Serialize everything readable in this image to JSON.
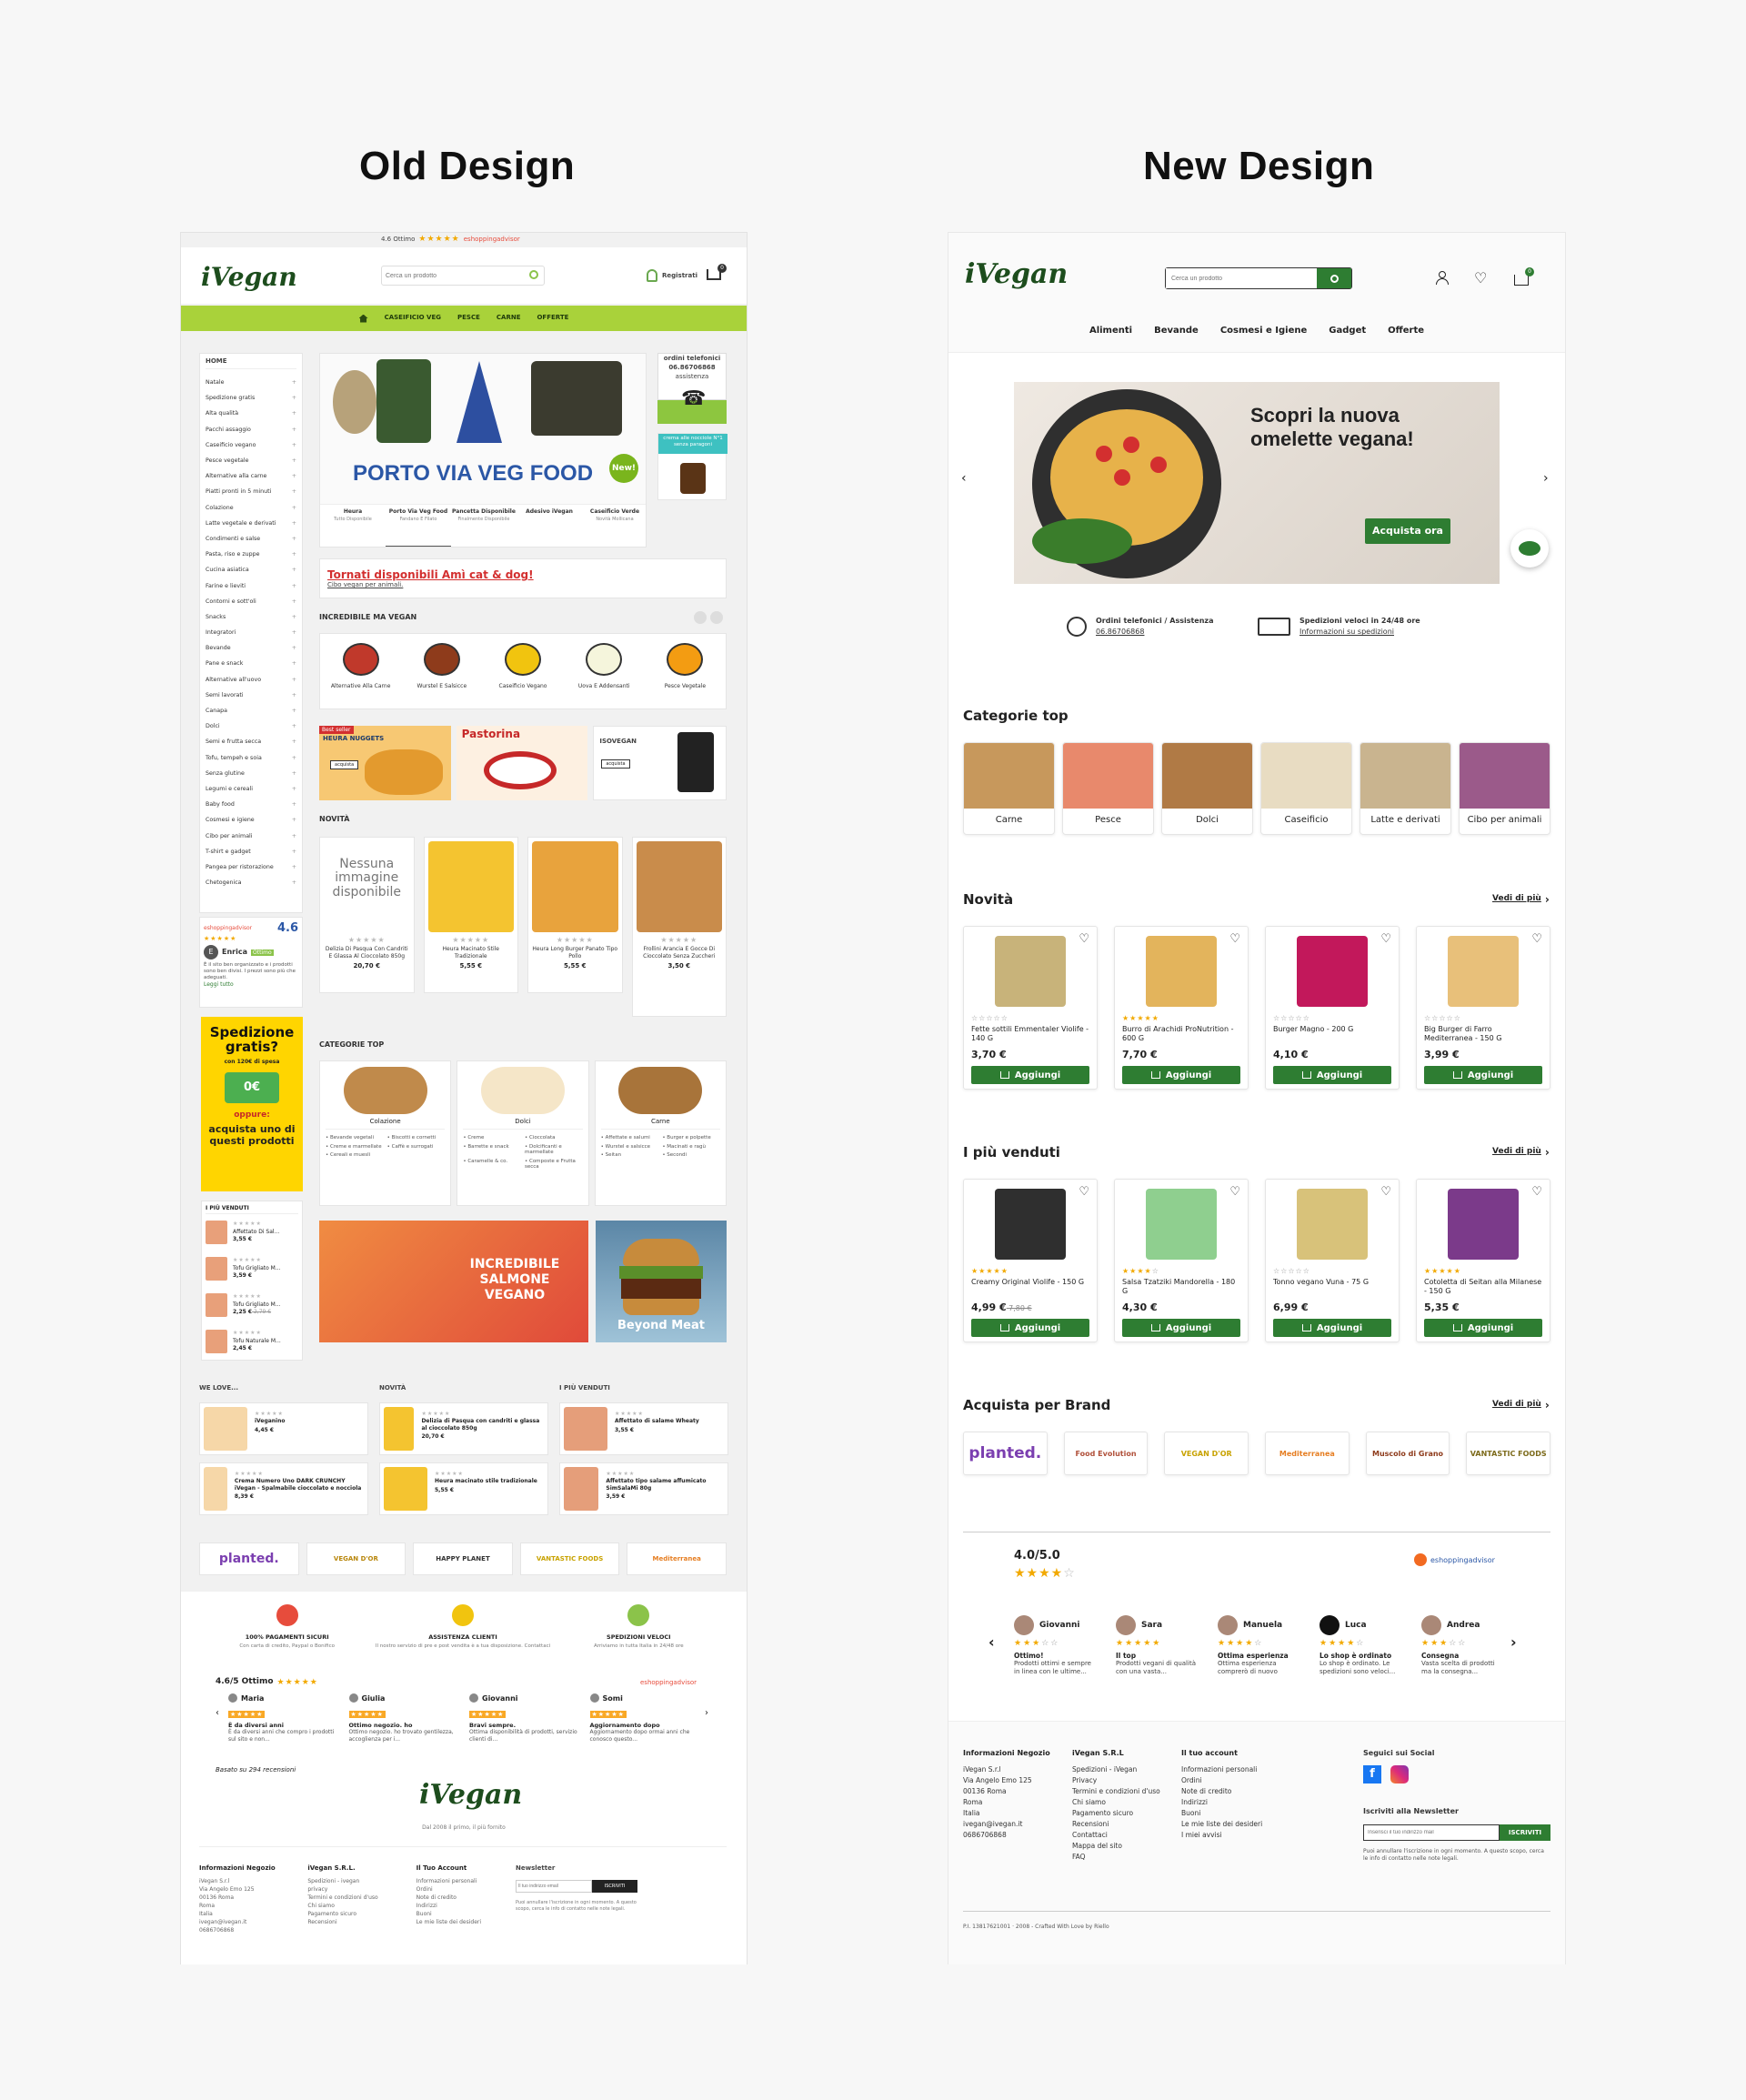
{
  "titles": {
    "old": "Old Design",
    "new": "New Design"
  },
  "old": {
    "rating_bar": "4.6 Ottimo",
    "rating_brand": "eshoppingadvisor",
    "logo": "iVegan",
    "search_placeholder": "Cerca un prodotto",
    "register": "Registrati",
    "cart_count": "0",
    "nav": [
      "CASEIFICIO VEG",
      "PESCE",
      "CARNE",
      "OFFERTE"
    ],
    "sidebar_home": "HOME",
    "sidebar": [
      "Natale",
      "Spedizione gratis",
      "Alta qualità",
      "Pacchi assaggio",
      "Caseificio vegano",
      "Pesce vegetale",
      "Alternative alla carne",
      "Piatti pronti in 5 minuti",
      "Colazione",
      "Latte vegetale e derivati",
      "Condimenti e salse",
      "Pasta, riso e zuppe",
      "Cucina asiatica",
      "Farine e lieviti",
      "Contorni e sott'oli",
      "Snacks",
      "Integratori",
      "Bevande",
      "Pane e snack",
      "Alternative all'uovo",
      "Semi lavorati",
      "Canapa",
      "Dolci",
      "Semi e frutta secca",
      "Tofu, tempeh e soia",
      "Senza glutine",
      "Legumi e cereali",
      "Baby food",
      "Cosmesi e igiene",
      "Cibo per animali",
      "T-shirt e gadget",
      "Pangea per ristorazione",
      "Chetogenica"
    ],
    "hero_text": "PORTO VIA VEG FOOD",
    "hero_badge": "New!",
    "hero_tabs": [
      {
        "t": "Heura",
        "s": "Tutto Disponibile"
      },
      {
        "t": "Porto Via Veg Food",
        "s": "Fandano E Filato"
      },
      {
        "t": "Pancetta Disponibile",
        "s": "Finalmente Disponibile"
      },
      {
        "t": "Adesivo iVegan",
        "s": ""
      },
      {
        "t": "Caseificio Verde",
        "s": "Novità Mollicana"
      }
    ],
    "phone_title": "ordini telefonici",
    "phone_number": "06.86706868",
    "phone_sub": "assistenza",
    "promo_side": "crema alle nocciole N°1 senza paragoni",
    "back_title": "Tornati disponibili Amì cat & dog!",
    "back_sub": "Cibo vegan per animali.",
    "incredibile_title": "INCREDIBILE MA VEGAN",
    "incredibile": [
      "Alternative Alla Carne",
      "Wurstel E Salsicce",
      "Caseificio Vegano",
      "Uova E Addensanti",
      "Pesce Vegetale"
    ],
    "banners": [
      "HEURA NUGGETS",
      "Pastorina",
      "ISOVEGAN"
    ],
    "banner_badge": "Best seller",
    "banner_btn": "acquista",
    "novita_title": "NOVITÀ",
    "no_image": "Nessuna immagine disponibile",
    "novita": [
      {
        "n": "Delizia Di Pasqua Con Candriti E Glassa Al Cioccolato 850g",
        "p": "20,70 €"
      },
      {
        "n": "Heura Macinato Stile Tradizionale",
        "p": "5,55 €"
      },
      {
        "n": "Heura Long Burger Panato Tipo Pollo",
        "p": "5,55 €"
      },
      {
        "n": "Frollini Arancia E Gocce Di Cioccolato Senza Zuccheri",
        "p": "3,50 €"
      }
    ],
    "review_score": "4.6",
    "review_name": "Enrica",
    "review_badge": "Ottimo",
    "review_text": "È il sito ben organizzato e i prodotti sono ben divisi. I prezzi sono più che adeguati.",
    "review_more": "Leggi tutto",
    "ship_title": "Spedizione gratis?",
    "ship_sub": "con 120€ di spesa",
    "ship_price": "0€",
    "ship_or": "oppure:",
    "ship_cta": "acquista uno di questi prodotti",
    "bestseller_title": "I PIÙ VENDUTI",
    "bestsellers": [
      {
        "n": "Affettato Di Sal...",
        "p": "3,55 €",
        "o": ""
      },
      {
        "n": "Tofu Grigliato M...",
        "p": "3,59 €",
        "o": ""
      },
      {
        "n": "Tofu Grigliato M...",
        "p": "2,25 €",
        "o": "2,79 €"
      },
      {
        "n": "Tofu Naturale M...",
        "p": "2,45 €",
        "o": ""
      }
    ],
    "cat_top_title": "CATEGORIE TOP",
    "cat_top": [
      {
        "t": "Colazione",
        "l": [
          "Bevande vegetali",
          "Biscotti e cornetti",
          "Creme e marmellate",
          "Caffè e surrogati",
          "Cereali e muesli"
        ]
      },
      {
        "t": "Dolci",
        "l": [
          "Creme",
          "Cioccolata",
          "Barrette e snack",
          "Dolcificanti e marmellate",
          "Caramelle & co.",
          "Composte e Frutta secca"
        ]
      },
      {
        "t": "Carne",
        "l": [
          "Affettate e salumi",
          "Burger e polpette",
          "Wurstel e salsicce",
          "Macinati e ragù",
          "Seitan",
          "Secondi"
        ]
      }
    ],
    "promo1": "INCREDIBILE SALMONE VEGANO",
    "promo2": "Beyond Meat",
    "welove_title": "WE LOVE...",
    "welove": [
      {
        "n": "iVeganino",
        "p": "4,45 €"
      },
      {
        "n": "Crema Numero Uno DARK CRUNCHY iVegan - Spalmabile cioccolato e nocciola",
        "p": "8,39 €"
      }
    ],
    "novita2_title": "NOVITÀ",
    "novita2": [
      {
        "n": "Delizia di Pasqua con candriti e glassa al cioccolato 850g",
        "p": "20,70 €"
      },
      {
        "n": "Heura macinato stile tradizionale",
        "p": "5,55 €"
      }
    ],
    "piu2_title": "I PIÙ VENDUTI",
    "piu2": [
      {
        "n": "Affettato di salame Wheaty",
        "p": "3,55 €"
      },
      {
        "n": "Affettato tipo salame affumicato SimSalaMi 80g",
        "p": "3,59 €"
      }
    ],
    "brands": [
      "planted.",
      "VEGAN D'OR",
      "HAPPY PLANET",
      "VANTASTIC FOODS",
      "Mediterranea"
    ],
    "features": [
      {
        "t": "100% PAGAMENTI SICURI",
        "s": "Con carta di credito, Paypal o Bonifico"
      },
      {
        "t": "ASSISTENZA CLIENTI",
        "s": "Il nostro servizio di pre e post vendita è a tua disposizione. Contattaci"
      },
      {
        "t": "SPEDIZIONI VELOCI",
        "s": "Arriviamo in tutta Italia in 24/48 ore"
      }
    ],
    "foot_rating": "4.6/5 Ottimo",
    "foot_reviews": [
      {
        "n": "Maria",
        "t": "È da diversi anni",
        "s": "È da diversi anni che compro i prodotti sul sito e non..."
      },
      {
        "n": "Giulia",
        "t": "Ottimo negozio. ho",
        "s": "Ottimo negozio. ho trovato gentilezza, accoglienza per i..."
      },
      {
        "n": "Giovanni",
        "t": "Bravi sempre.",
        "s": "Ottima disponibilità di prodotti, servizio clienti di..."
      },
      {
        "n": "Somi",
        "t": "Aggiornamento dopo",
        "s": "Aggiornamento dopo ormai anni che conosco questo..."
      }
    ],
    "based_on": "Basato su 294 recensioni",
    "since": "Dal 2008 il primo, il più fornito",
    "foot_cols": [
      {
        "t": "Informazioni Negozio",
        "l": [
          "iVegan S.r.l",
          "Via Angelo Emo 125",
          "00136 Roma",
          "Roma",
          "Italia",
          "ivegan@ivegan.it",
          "0686706868"
        ]
      },
      {
        "t": "iVegan S.R.L.",
        "l": [
          "Spedizioni - ivegan",
          "privacy",
          "Termini e condizioni d'uso",
          "Chi siamo",
          "Pagamento sicuro",
          "Recensioni"
        ]
      },
      {
        "t": "Il Tuo Account",
        "l": [
          "Informazioni personali",
          "Ordini",
          "Note di credito",
          "Indirizzi",
          "Buoni",
          "Le mie liste dei desideri"
        ]
      }
    ],
    "newsletter_title": "Newsletter",
    "newsletter_placeholder": "Il tuo indirizzo email",
    "newsletter_btn": "ISCRIVITI",
    "newsletter_note": "Puoi annullare l'iscrizione in ogni momento. A questo scopo, cerca le info di contatto nelle note legali."
  },
  "new": {
    "logo": "iVegan",
    "search_placeholder": "Cerca un prodotto",
    "cart_count": "0",
    "nav": [
      "Alimenti",
      "Bevande",
      "Cosmesi e Igiene",
      "Gadget",
      "Offerte"
    ],
    "hero_title": "Scopri la nuova omelette vegana!",
    "hero_btn": "Acquista ora",
    "info1_title": "Ordini telefonici / Assistenza",
    "info1_link": "06.86706868",
    "info2_title": "Spedizioni veloci in 24/48 ore",
    "info2_link": "Informazioni su spedizioni",
    "cat_title": "Categorie top",
    "cats": [
      "Carne",
      "Pesce",
      "Dolci",
      "Caseificio",
      "Latte e derivati",
      "Cibo per animali"
    ],
    "novita_title": "Novità",
    "see_more": "Vedi di più",
    "novita": [
      {
        "n": "Fette sottili Emmentaler Violife - 140 G",
        "p": "3,70 €",
        "o": ""
      },
      {
        "n": "Burro di Arachidi ProNutrition - 600 G",
        "p": "7,70 €",
        "o": ""
      },
      {
        "n": "Burger Magno - 200 G",
        "p": "4,10 €",
        "o": ""
      },
      {
        "n": "Big Burger di Farro Mediterranea - 150 G",
        "p": "3,99 €",
        "o": ""
      }
    ],
    "piu_title": "I più venduti",
    "piu": [
      {
        "n": "Creamy Original Violife - 150 G",
        "p": "4,99 €",
        "o": "7,80 €"
      },
      {
        "n": "Salsa Tzatziki Mandorella - 180 G",
        "p": "4,30 €",
        "o": ""
      },
      {
        "n": "Tonno vegano Vuna - 75 G",
        "p": "6,99 €",
        "o": ""
      },
      {
        "n": "Cotoletta di Seitan alla Milanese - 150 G",
        "p": "5,35 €",
        "o": ""
      }
    ],
    "add_btn": "Aggiungi",
    "brand_title": "Acquista per Brand",
    "brands": [
      "planted.",
      "Food Evolution",
      "VEGAN D'OR",
      "Mediterranea",
      "Muscolo di Grano",
      "VANTASTIC FOODS"
    ],
    "rating": "4.0/5.0",
    "rating_brand": "eshoppingadvisor",
    "reviews": [
      {
        "n": "Giovanni",
        "t": "Ottimo!",
        "s": "Prodotti ottimi e sempre in linea con le ultime..."
      },
      {
        "n": "Sara",
        "t": "Il top",
        "s": "Prodotti vegani di qualità con una vasta..."
      },
      {
        "n": "Manuela",
        "t": "Ottima esperienza",
        "s": "Ottima esperienza comprerò di nuovo"
      },
      {
        "n": "Luca",
        "t": "Lo shop è ordinato",
        "s": "Lo shop è ordinato. Le spedizioni sono veloci..."
      },
      {
        "n": "Andrea",
        "t": "Consegna",
        "s": "Vasta scelta di prodotti ma la consegna..."
      }
    ],
    "foot_cols": [
      {
        "t": "Informazioni Negozio",
        "l": [
          "iVegan S.r.l",
          "Via Angelo Emo 125",
          "00136 Roma",
          "Roma",
          "Italia",
          "ivegan@ivegan.it",
          "0686706868"
        ]
      },
      {
        "t": "iVegan S.R.L",
        "l": [
          "Spedizioni - iVegan",
          "Privacy",
          "Termini e condizioni d'uso",
          "Chi siamo",
          "Pagamento sicuro",
          "Recensioni",
          "Contattaci",
          "Mappa del sito",
          "FAQ"
        ]
      },
      {
        "t": "Il tuo account",
        "l": [
          "Informazioni personali",
          "Ordini",
          "Note di credito",
          "Indirizzi",
          "Buoni",
          "Le mie liste dei desideri",
          "I miei avvisi"
        ]
      }
    ],
    "social_title": "Seguici sui Social",
    "newsletter_title": "Iscriviti alla Newsletter",
    "newsletter_placeholder": "Inserisci il tuo indirizzo mail",
    "newsletter_btn": "ISCRIVITI",
    "newsletter_note": "Puoi annullare l'iscrizione in ogni momento. A questo scopo, cerca le info di contatto nelle note legali.",
    "copyright": "P.I. 13817621001 · 2008 - Crafted With Love by Riello"
  }
}
